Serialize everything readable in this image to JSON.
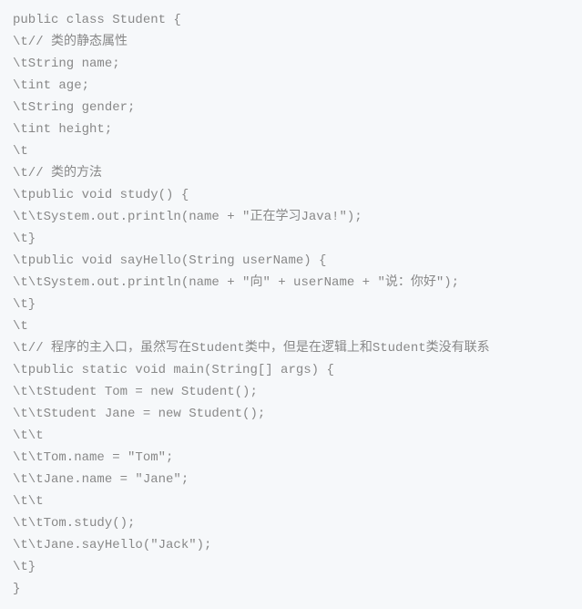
{
  "code": {
    "lines": [
      "public class Student {",
      "\\t// 类的静态属性",
      "\\tString name;",
      "\\tint age;",
      "\\tString gender;",
      "\\tint height;",
      "\\t",
      "\\t// 类的方法",
      "\\tpublic void study() {",
      "\\t\\tSystem.out.println(name + \"正在学习Java!\");",
      "\\t}",
      "\\tpublic void sayHello(String userName) {",
      "\\t\\tSystem.out.println(name + \"向\" + userName + \"说：你好\");",
      "\\t}",
      "\\t",
      "\\t// 程序的主入口，虽然写在Student类中，但是在逻辑上和Student类没有联系",
      "\\tpublic static void main(String[] args) {",
      "\\t\\tStudent Tom = new Student();",
      "\\t\\tStudent Jane = new Student();",
      "\\t\\t",
      "\\t\\tTom.name = \"Tom\";",
      "\\t\\tJane.name = \"Jane\";",
      "\\t\\t",
      "\\t\\tTom.study();",
      "\\t\\tJane.sayHello(\"Jack\");",
      "\\t}",
      "}"
    ]
  }
}
